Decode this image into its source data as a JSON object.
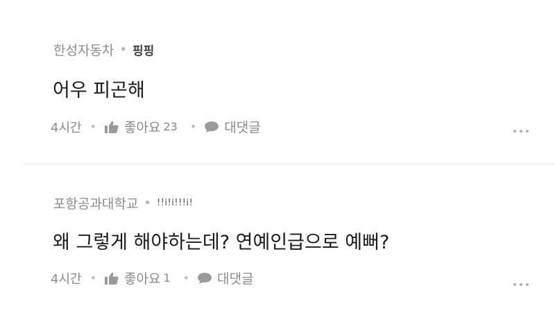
{
  "comments": [
    {
      "org": "한성자동차",
      "nickname": "핑핑",
      "text": "어우 피곤해",
      "time": "4시간",
      "like_label": "좋아요",
      "like_count": "23",
      "reply_label": "대댓글"
    },
    {
      "org": "포항공과대학교",
      "nickname": "!!i!i!!!i!",
      "text": "왜 그렇게 해야하는데? 연예인급으로 예뻐?",
      "time": "4시간",
      "like_label": "좋아요",
      "like_count": "1",
      "reply_label": "대댓글"
    }
  ],
  "icons": {
    "like": "thumbs-up-icon",
    "reply": "speech-bubble-icon",
    "more": "more-dots-icon"
  },
  "colors": {
    "text_primary": "#1a1a1a",
    "text_meta": "#8c8c8c",
    "icon_gray": "#9a9a9a",
    "divider": "#e6e6e6"
  }
}
